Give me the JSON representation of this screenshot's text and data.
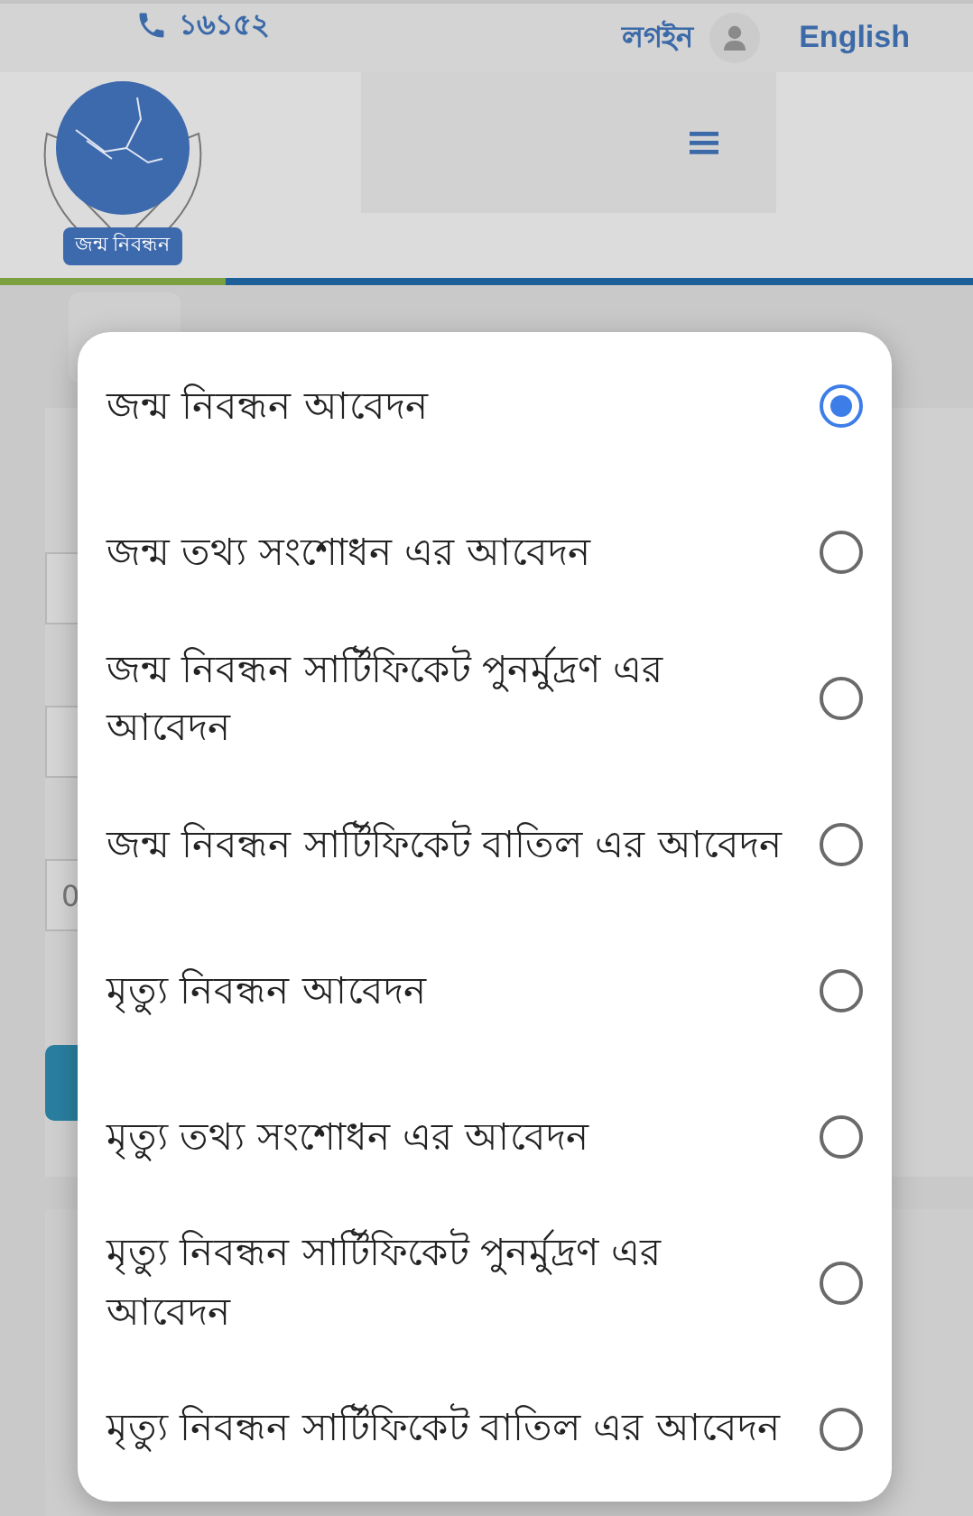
{
  "top_bar": {
    "phone": "১৬১৫২",
    "login": "লগইন",
    "language": "English"
  },
  "logo": {
    "caption": "জন্ম নিবন্ধন"
  },
  "background_form": {
    "field_value": "0"
  },
  "dialog": {
    "options": [
      {
        "label": "জন্ম নিবন্ধন আবেদন",
        "selected": true
      },
      {
        "label": "জন্ম তথ্য সংশোধন এর আবেদন",
        "selected": false
      },
      {
        "label": "জন্ম নিবন্ধন সার্টিফিকেট পুনর্মুদ্রণ এর আবেদন",
        "selected": false
      },
      {
        "label": "জন্ম নিবন্ধন সার্টিফিকেট বাতিল এর আবেদন",
        "selected": false
      },
      {
        "label": "মৃত্যু নিবন্ধন আবেদন",
        "selected": false
      },
      {
        "label": "মৃত্যু তথ্য সংশোধন এর আবেদন",
        "selected": false
      },
      {
        "label": "মৃত্যু নিবন্ধন সার্টিফিকেট পুনর্মুদ্রণ এর আবেদন",
        "selected": false
      },
      {
        "label": "মৃত্যু নিবন্ধন সার্টিফিকেট বাতিল এর আবেদন",
        "selected": false
      }
    ]
  }
}
